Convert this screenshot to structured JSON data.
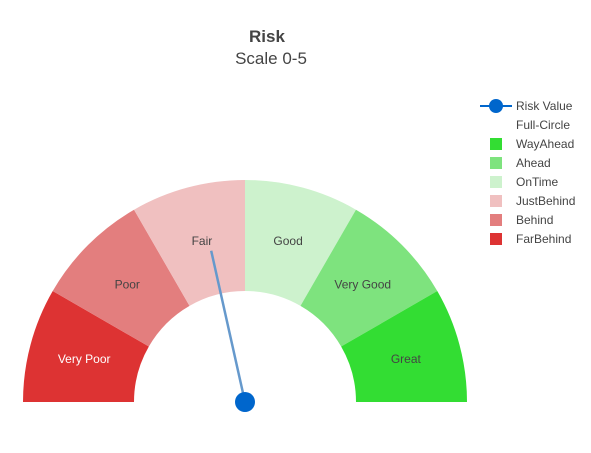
{
  "chart_data": {
    "type": "gauge",
    "title": "Risk",
    "subtitle": "Scale 0-5",
    "range": [
      0,
      5
    ],
    "value": 2.15,
    "segments": [
      {
        "label": "Very Poor",
        "from": 0.0,
        "to": 0.833,
        "color": "#dd3333",
        "text_color": "#ffffff"
      },
      {
        "label": "Poor",
        "from": 0.833,
        "to": 1.667,
        "color": "#e37e7e",
        "text_color": "#444444"
      },
      {
        "label": "Fair",
        "from": 1.667,
        "to": 2.5,
        "color": "#f0c0c0",
        "text_color": "#444444"
      },
      {
        "label": "Good",
        "from": 2.5,
        "to": 3.333,
        "color": "#cdf2cd",
        "text_color": "#444444"
      },
      {
        "label": "Very Good",
        "from": 3.333,
        "to": 4.167,
        "color": "#7ee37e",
        "text_color": "#444444"
      },
      {
        "label": "Great",
        "from": 4.167,
        "to": 5.0,
        "color": "#33dd33",
        "text_color": "#444444"
      }
    ],
    "legend": {
      "placement": "top-right",
      "items": [
        {
          "label": "Risk Value",
          "marker": "line-dot",
          "color": "#0066cc"
        },
        {
          "label": "Full-Circle",
          "marker": "none",
          "color": ""
        },
        {
          "label": "WayAhead",
          "marker": "square",
          "color": "#33dd33"
        },
        {
          "label": "Ahead",
          "marker": "square",
          "color": "#7ee37e"
        },
        {
          "label": "OnTime",
          "marker": "square",
          "color": "#cdf2cd"
        },
        {
          "label": "JustBehind",
          "marker": "square",
          "color": "#f0c0c0"
        },
        {
          "label": "Behind",
          "marker": "square",
          "color": "#e37e7e"
        },
        {
          "label": "FarBehind",
          "marker": "square",
          "color": "#dd3333"
        }
      ]
    },
    "needle_color": "#6699cc",
    "hub_color": "#0066cc"
  }
}
